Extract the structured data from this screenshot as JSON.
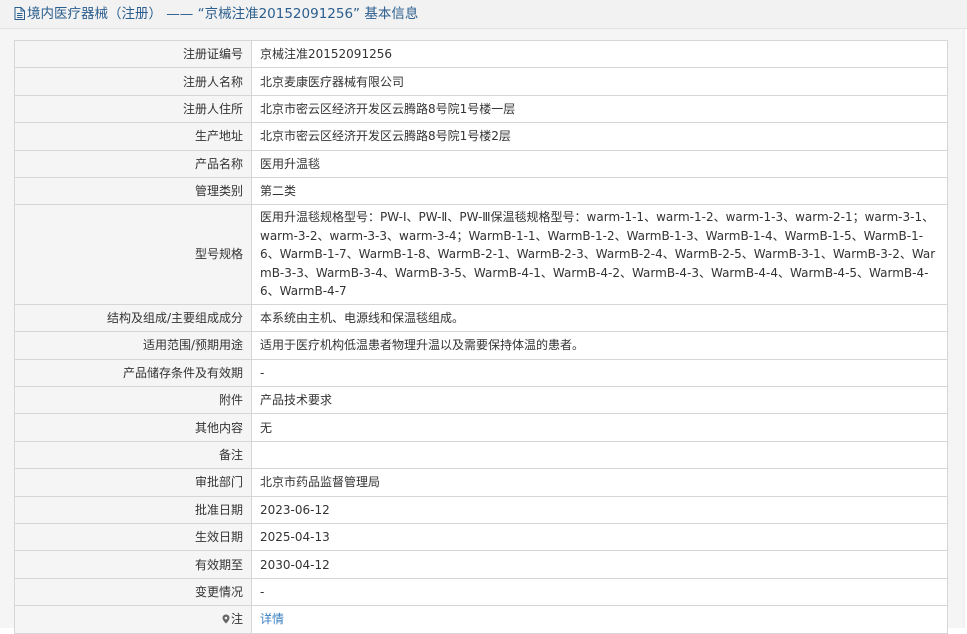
{
  "header": {
    "title": "境内医疗器械（注册） —— “京械注准20152091256” 基本信息"
  },
  "rows": [
    {
      "label": "注册证编号",
      "value": "京械注准20152091256"
    },
    {
      "label": "注册人名称",
      "value": "北京麦康医疗器械有限公司"
    },
    {
      "label": "注册人住所",
      "value": "北京市密云区经济开发区云腾路8号院1号楼一层"
    },
    {
      "label": "生产地址",
      "value": "北京市密云区经济开发区云腾路8号院1号楼2层"
    },
    {
      "label": "产品名称",
      "value": "医用升温毯"
    },
    {
      "label": "管理类别",
      "value": "第二类"
    },
    {
      "label": "型号规格",
      "value": "医用升温毯规格型号：PW-Ⅰ、PW-Ⅱ、PW-Ⅲ保温毯规格型号：warm-1-1、warm-1-2、warm-1-3、warm-2-1；warm-3-1、warm-3-2、warm-3-3、warm-3-4；WarmB-1-1、WarmB-1-2、WarmB-1-3、WarmB-1-4、WarmB-1-5、WarmB-1-6、WarmB-1-7、WarmB-1-8、WarmB-2-1、WarmB-2-3、WarmB-2-4、WarmB-2-5、WarmB-3-1、WarmB-3-2、WarmB-3-3、WarmB-3-4、WarmB-3-5、WarmB-4-1、WarmB-4-2、WarmB-4-3、WarmB-4-4、WarmB-4-5、WarmB-4-6、WarmB-4-7"
    },
    {
      "label": "结构及组成/主要组成成分",
      "value": "本系统由主机、电源线和保温毯组成。"
    },
    {
      "label": "适用范围/预期用途",
      "value": "适用于医疗机构低温患者物理升温以及需要保持体温的患者。"
    },
    {
      "label": "产品储存条件及有效期",
      "value": "-"
    },
    {
      "label": "附件",
      "value": "产品技术要求"
    },
    {
      "label": "其他内容",
      "value": "无"
    },
    {
      "label": "备注",
      "value": ""
    },
    {
      "label": "审批部门",
      "value": "北京市药品监督管理局"
    },
    {
      "label": "批准日期",
      "value": "2023-06-12"
    },
    {
      "label": "生效日期",
      "value": "2025-04-13"
    },
    {
      "label": "有效期至",
      "value": "2030-04-12"
    },
    {
      "label": "变更情况",
      "value": "-"
    }
  ],
  "note": {
    "icon": "location-pin-icon",
    "label": "注",
    "link_text": "详情"
  },
  "colors": {
    "header_text": "#2b5e8e",
    "link": "#3a7fc1",
    "label_bg": "#f5f5f5",
    "border": "#d6d6d6"
  }
}
